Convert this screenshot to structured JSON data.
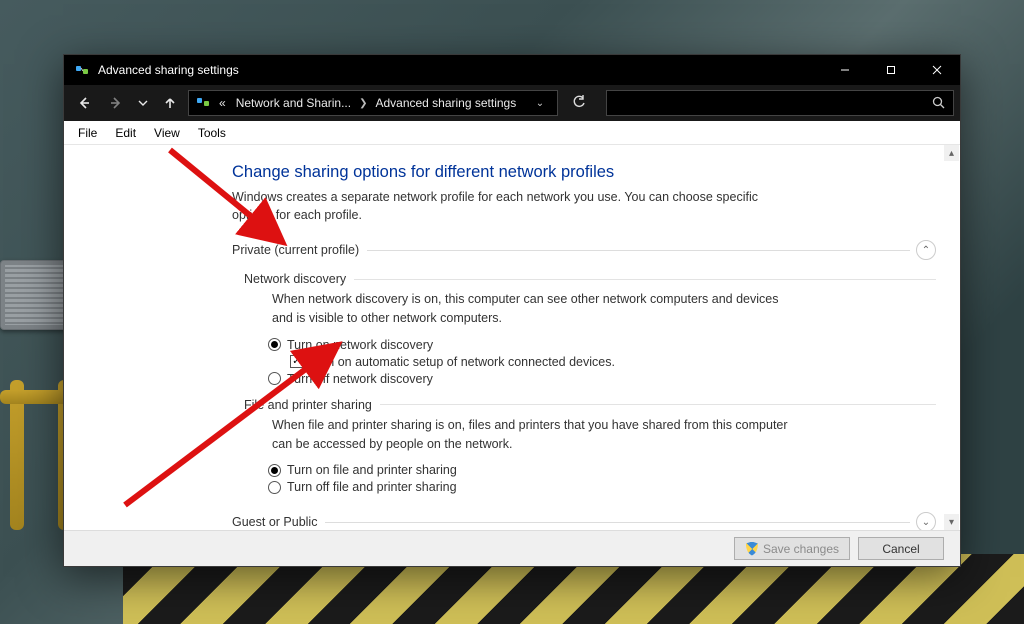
{
  "window": {
    "title": "Advanced sharing settings"
  },
  "breadcrumbs": {
    "prefix": "«",
    "a": "Network and Sharin...",
    "b": "Advanced sharing settings"
  },
  "menus": {
    "file": "File",
    "edit": "Edit",
    "view": "View",
    "tools": "Tools"
  },
  "page": {
    "title": "Change sharing options for different network profiles",
    "sub": "Windows creates a separate network profile for each network you use. You can choose specific options for each profile."
  },
  "profile_private": {
    "label": "Private (current profile)"
  },
  "net_disc": {
    "title": "Network discovery",
    "desc": "When network discovery is on, this computer can see other network computers and devices and is visible to other network computers.",
    "opt_on": "Turn on network discovery",
    "opt_on_selected": true,
    "auto_setup": "Turn on automatic setup of network connected devices.",
    "auto_setup_checked": true,
    "opt_off": "Turn off network discovery"
  },
  "file_print": {
    "title": "File and printer sharing",
    "desc": "When file and printer sharing is on, files and printers that you have shared from this computer can be accessed by people on the network.",
    "opt_on": "Turn on file and printer sharing",
    "opt_on_selected": true,
    "opt_off": "Turn off file and printer sharing"
  },
  "guest_public": {
    "label": "Guest or Public"
  },
  "buttons": {
    "save": "Save changes",
    "cancel": "Cancel"
  }
}
